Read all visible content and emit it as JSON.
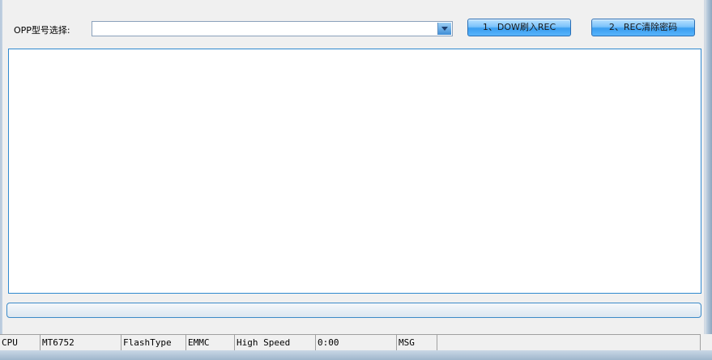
{
  "form": {
    "model_label": "OPP型号选择:",
    "model_value": "",
    "button1_label": "1、DOW刷入REC",
    "button2_label": "2、REC清除密码"
  },
  "progress": {
    "value": 0
  },
  "status": {
    "cells": [
      "CPU",
      "MT6752",
      "FlashType",
      "EMMC",
      "High Speed",
      "0:00",
      "MSG",
      ""
    ]
  },
  "icons": {
    "dropdown": "chevron-down-icon"
  }
}
